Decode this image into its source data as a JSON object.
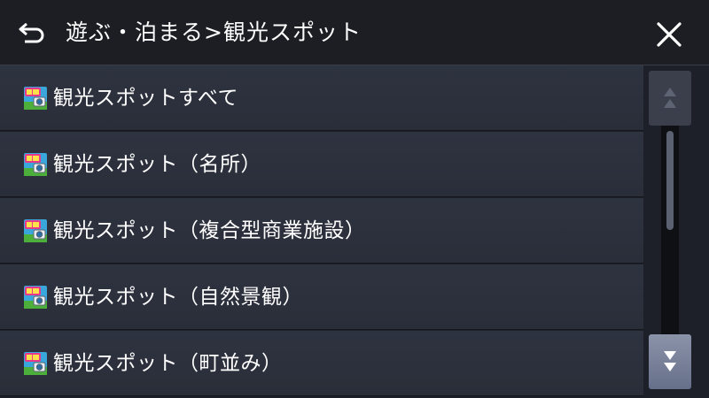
{
  "header": {
    "back_icon": "return-arrow-icon",
    "title": "遊ぶ・泊まる>観光スポット",
    "close_icon": "close-x-icon"
  },
  "list": {
    "item_icon": "sightseeing-camera-icon",
    "items": [
      {
        "label": "観光スポットすべて"
      },
      {
        "label": "観光スポット（名所）"
      },
      {
        "label": "観光スポット（複合型商業施設）"
      },
      {
        "label": "観光スポット（自然景観）"
      },
      {
        "label": "観光スポット（町並み）"
      }
    ]
  },
  "scrollbar": {
    "up_icon": "page-up-double-triangle-icon",
    "down_icon": "page-down-double-triangle-icon",
    "up_enabled": false,
    "down_enabled": true,
    "thumb_start_fraction": 0.0,
    "thumb_size_fraction": 0.5
  },
  "colors": {
    "background": "#1d2028",
    "header_bg": "#1c1e24",
    "row_bg": "#2c303b",
    "text": "#ffffff",
    "scroll_button_active": "#7a839a",
    "scroll_button_disabled": "#3a3f4b"
  }
}
